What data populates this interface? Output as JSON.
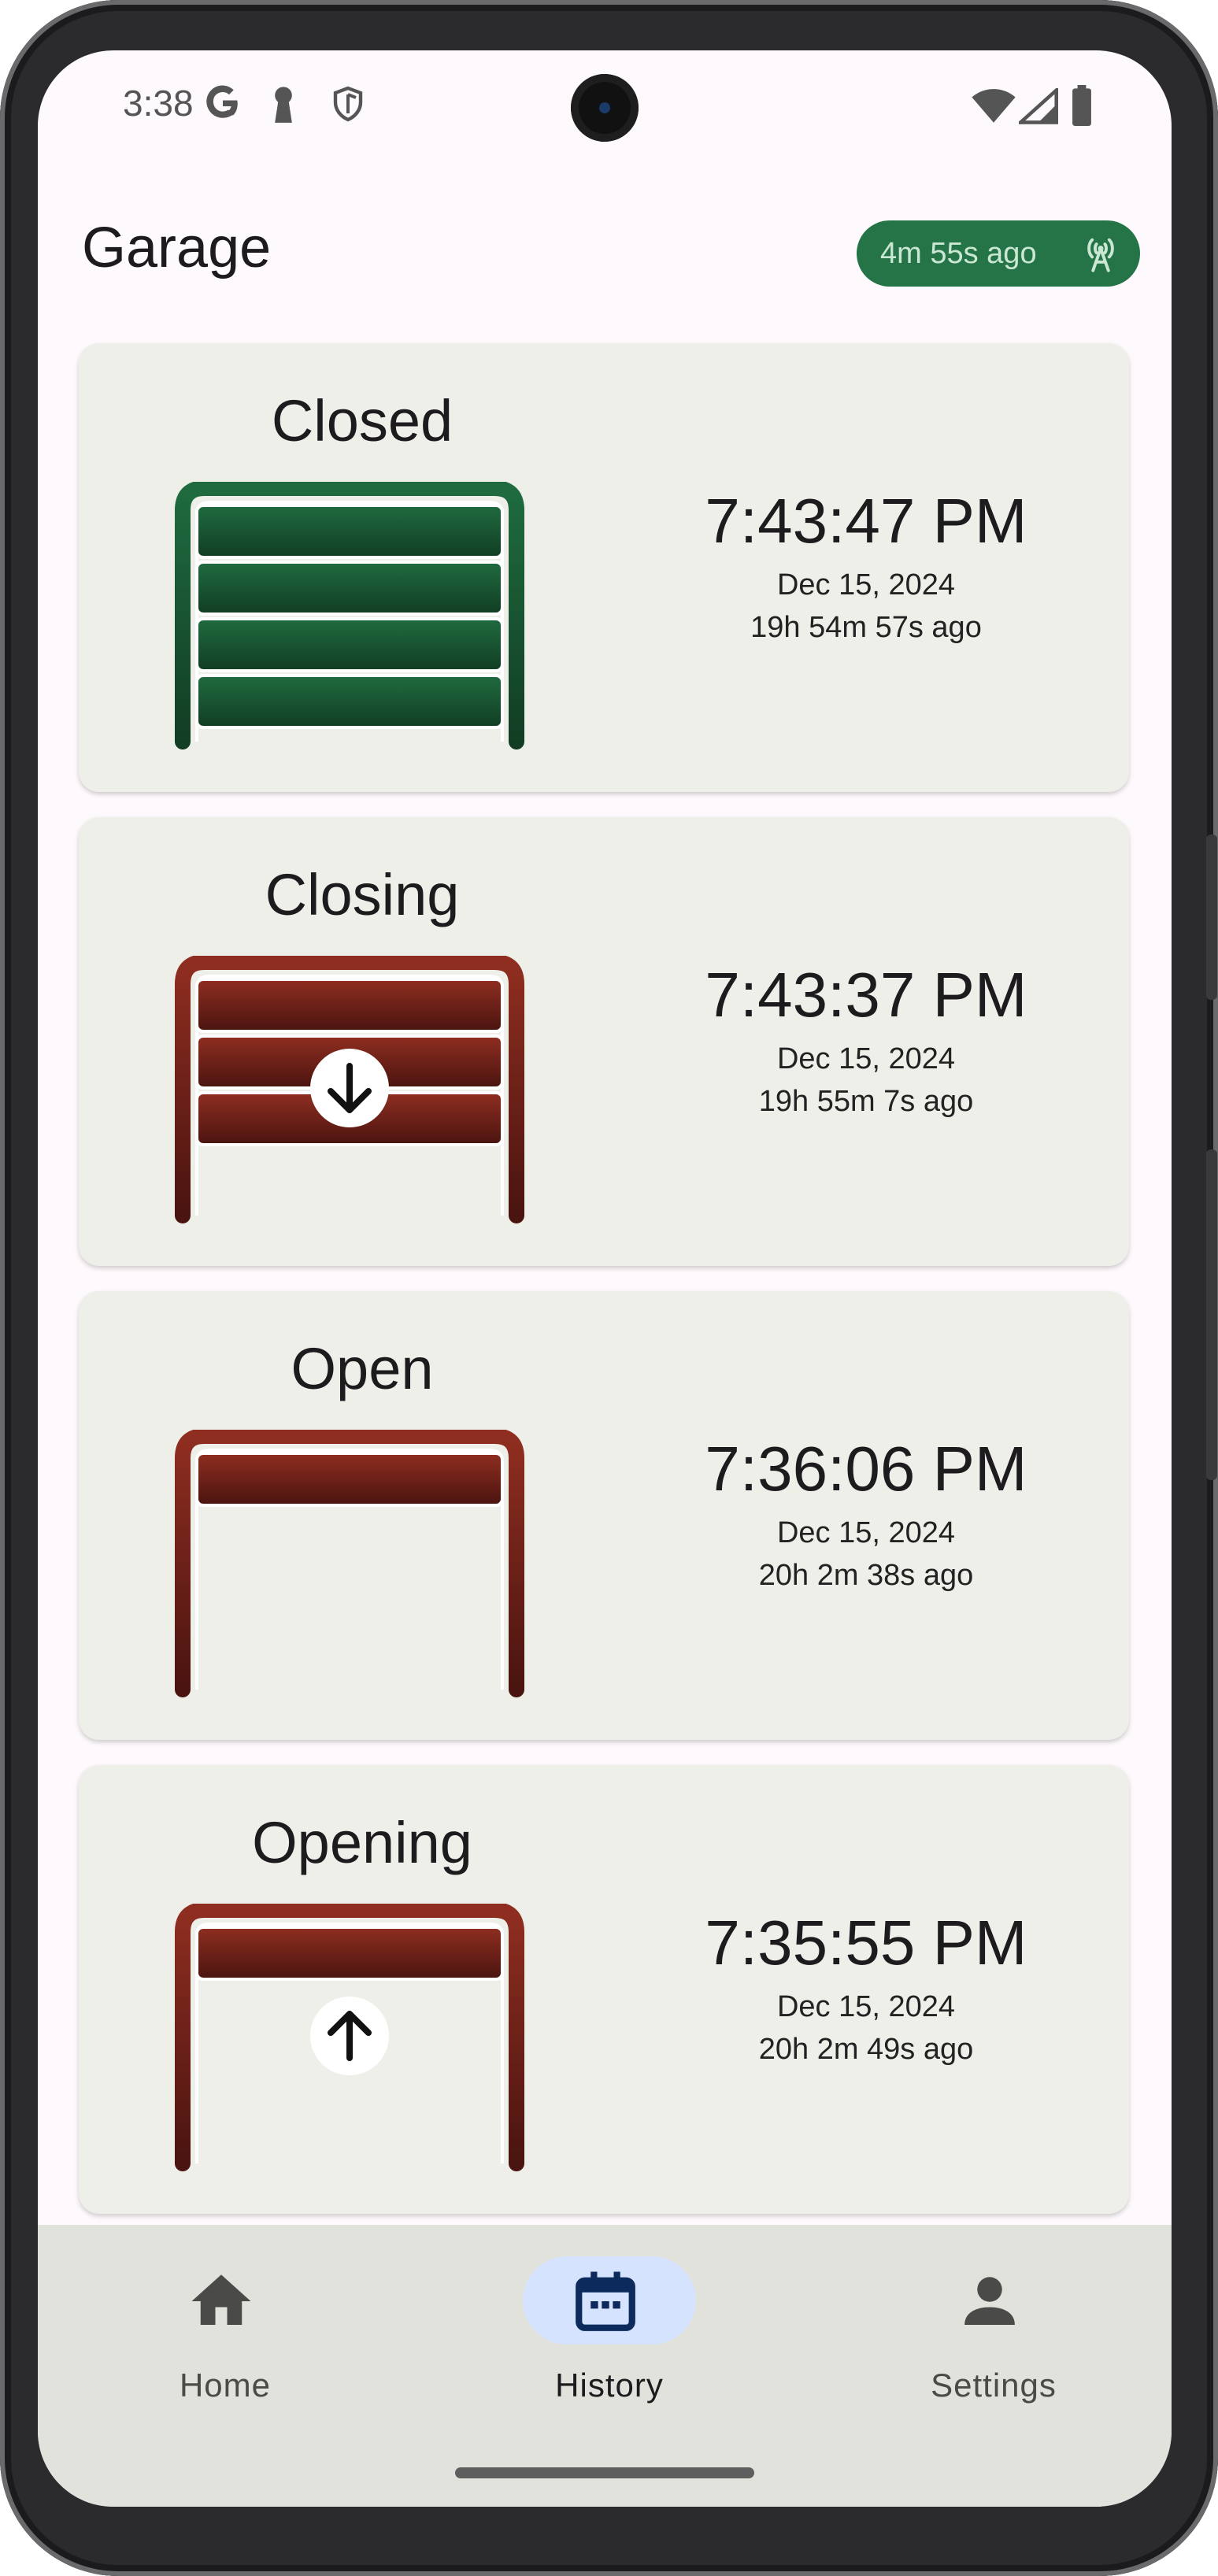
{
  "status_bar": {
    "time": "3:38"
  },
  "header": {
    "title": "Garage",
    "last_update": "4m 55s ago"
  },
  "events": [
    {
      "state": "Closed",
      "time": "7:43:47 PM",
      "date": "Dec 15, 2024",
      "ago": "19h 54m 57s ago",
      "door": "closed",
      "color": "#1f6b3f"
    },
    {
      "state": "Closing",
      "time": "7:43:37 PM",
      "date": "Dec 15, 2024",
      "ago": "19h 55m 7s ago",
      "door": "closing",
      "color": "#8f2e20"
    },
    {
      "state": "Open",
      "time": "7:36:06 PM",
      "date": "Dec 15, 2024",
      "ago": "20h 2m 38s ago",
      "door": "open",
      "color": "#8f2e20"
    },
    {
      "state": "Opening",
      "time": "7:35:55 PM",
      "date": "Dec 15, 2024",
      "ago": "20h 2m 49s ago",
      "door": "opening",
      "color": "#8f2e20"
    }
  ],
  "nav": {
    "items": [
      {
        "label": "Home",
        "icon": "home-icon"
      },
      {
        "label": "History",
        "icon": "calendar-icon",
        "active": true
      },
      {
        "label": "Settings",
        "icon": "person-icon"
      }
    ]
  },
  "colors": {
    "badge": "#257447",
    "closed": "#1f6b3f",
    "open": "#8f2e20",
    "nav_active": "#d6e3ff"
  }
}
